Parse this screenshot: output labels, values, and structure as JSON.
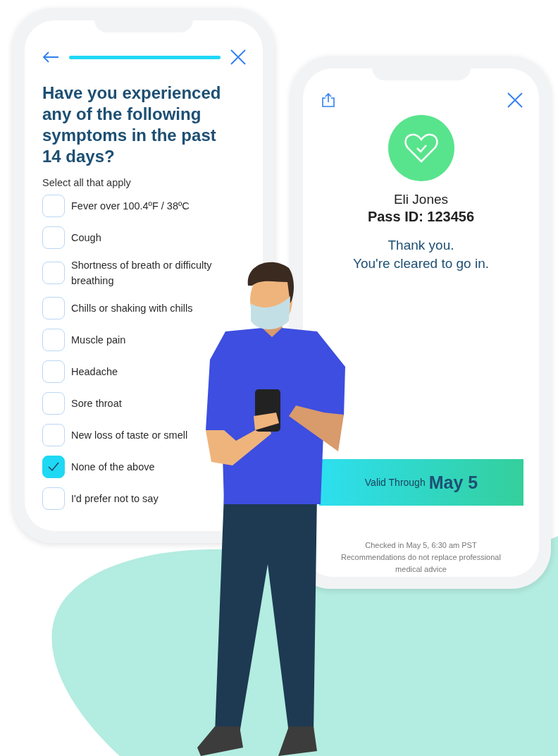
{
  "symptom_screen": {
    "progress": {
      "level": 1
    },
    "question": "Have you experienced any of the following symptoms in the past 14 days?",
    "hint": "Select all that apply",
    "options": [
      {
        "label": "Fever over 100.4ºF / 38ºC",
        "checked": false
      },
      {
        "label": "Cough",
        "checked": false
      },
      {
        "label": "Shortness of breath or difficulty breathing",
        "checked": false
      },
      {
        "label": "Chills or shaking with chills",
        "checked": false
      },
      {
        "label": "Muscle pain",
        "checked": false
      },
      {
        "label": "Headache",
        "checked": false
      },
      {
        "label": "Sore throat",
        "checked": false
      },
      {
        "label": "New loss of taste or smell",
        "checked": false
      },
      {
        "label": "None of the above",
        "checked": true
      },
      {
        "label": "I'd prefer not to say",
        "checked": false
      }
    ]
  },
  "pass_screen": {
    "name": "Eli Jones",
    "pass_id": "Pass ID: 123456",
    "message": [
      "Thank you.",
      "You're cleared to go in."
    ],
    "valid": {
      "label": "Valid Through",
      "date": "May 5"
    },
    "footer": [
      "Checked in May 5, 6:30 am PST",
      "Recommendations do not replace professional medical advice"
    ]
  }
}
